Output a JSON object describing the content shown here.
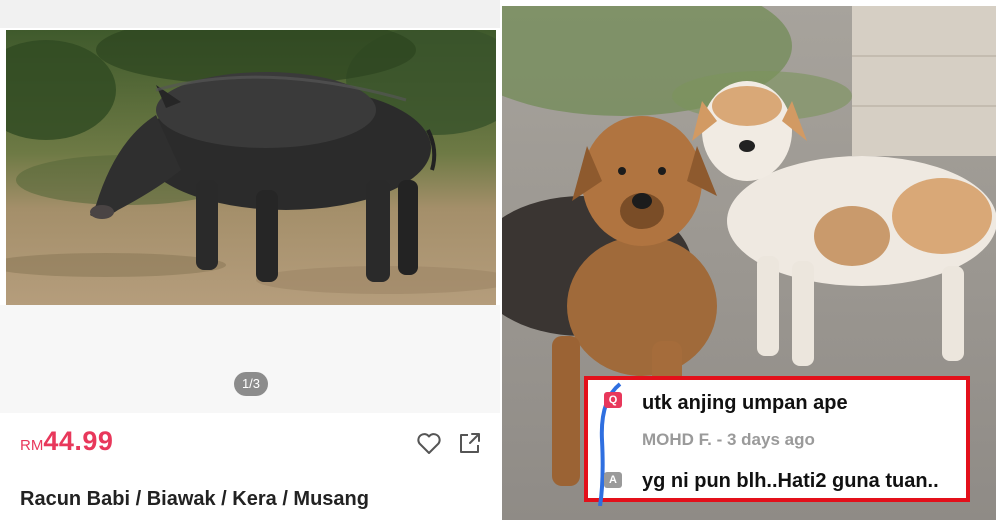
{
  "product": {
    "photo": "wild-boar-photo",
    "pager": "1/3",
    "price_currency": "RM",
    "price_amount": "44.99",
    "title": "Racun Babi / Biawak / Kera / Musang",
    "actions": [
      "heart-icon",
      "share-icon"
    ],
    "price_color": "#e8385b"
  },
  "comment": {
    "photo": "stray-dogs-photo",
    "question_badge": "Q",
    "question": "utk anjing umpan ape",
    "author_meta": "MOHD F. - 3  days ago",
    "answer_badge": "A",
    "answer": "yg ni pun blh..Hati2 guna tuan..",
    "highlight_color": "#e3101a"
  }
}
